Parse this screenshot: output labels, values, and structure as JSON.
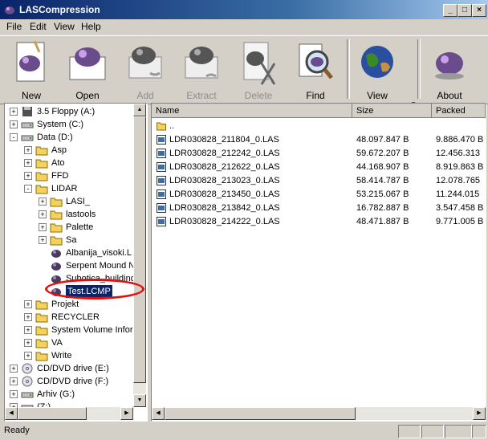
{
  "window": {
    "title": "LASCompression"
  },
  "menu": [
    {
      "label": "File"
    },
    {
      "label": "Edit"
    },
    {
      "label": "View"
    },
    {
      "label": "Help"
    }
  ],
  "toolbar": [
    {
      "label": "New",
      "enabled": true
    },
    {
      "label": "Open",
      "enabled": true
    },
    {
      "label": "Add",
      "enabled": false
    },
    {
      "label": "Extract",
      "enabled": false
    },
    {
      "label": "Delete",
      "enabled": false
    },
    {
      "label": "Find",
      "enabled": true
    },
    {
      "label": "View",
      "enabled": true
    },
    {
      "label": "About",
      "enabled": true
    }
  ],
  "tree": [
    {
      "label": "3.5 Floppy (A:)",
      "icon": "floppy-icon",
      "expander": "+"
    },
    {
      "label": "System (C:)",
      "icon": "drive-icon",
      "expander": "+"
    },
    {
      "label": "Data (D:)",
      "icon": "drive-icon",
      "expander": "-"
    },
    {
      "label": "Asp",
      "icon": "folder-icon",
      "expander": "+"
    },
    {
      "label": "Ato",
      "icon": "folder-icon",
      "expander": "+"
    },
    {
      "label": "FFD",
      "icon": "folder-icon",
      "expander": "+"
    },
    {
      "label": "LIDAR",
      "icon": "folder-icon",
      "expander": "-"
    },
    {
      "label": "LASI_",
      "icon": "folder-icon",
      "expander": "+"
    },
    {
      "label": "lastools",
      "icon": "folder-icon",
      "expander": "+"
    },
    {
      "label": "Palette",
      "icon": "folder-icon",
      "expander": "+"
    },
    {
      "label": "Sa",
      "icon": "folder-icon",
      "expander": "+"
    },
    {
      "label": "Albanija_visoki.L",
      "icon": "archive-icon",
      "expander": ""
    },
    {
      "label": "Serpent Mound N",
      "icon": "archive-icon",
      "expander": ""
    },
    {
      "label": "Subotica_building",
      "icon": "archive-icon",
      "expander": ""
    },
    {
      "label": "Test.LCMP",
      "icon": "archive-icon",
      "expander": "",
      "selected": true
    },
    {
      "label": "Projekt",
      "icon": "folder-icon",
      "expander": "+"
    },
    {
      "label": "RECYCLER",
      "icon": "folder-icon",
      "expander": "+"
    },
    {
      "label": "System Volume Infor",
      "icon": "folder-icon",
      "expander": "+"
    },
    {
      "label": "VA",
      "icon": "folder-icon",
      "expander": "+"
    },
    {
      "label": "Write",
      "icon": "folder-icon",
      "expander": "+"
    },
    {
      "label": "CD/DVD drive (E:)",
      "icon": "cd-drive-icon",
      "expander": "+"
    },
    {
      "label": "CD/DVD drive (F:)",
      "icon": "cd-drive-icon",
      "expander": "+"
    },
    {
      "label": "Arhiv (G:)",
      "icon": "drive-icon",
      "expander": "+"
    },
    {
      "label": "(Z:)",
      "icon": "drive-icon",
      "expander": "+"
    }
  ],
  "list": {
    "columns": [
      "Name",
      "Size",
      "Packed"
    ],
    "rows": [
      {
        "name": "..",
        "size": "",
        "packed": "",
        "icon": "folder-icon"
      },
      {
        "name": "LDR030828_211804_0.LAS",
        "size": "48.097.847 B",
        "packed": "9.886.470 B",
        "icon": "las-file-icon"
      },
      {
        "name": "LDR030828_212242_0.LAS",
        "size": "59.672.207 B",
        "packed": "12.456.313",
        "icon": "las-file-icon"
      },
      {
        "name": "LDR030828_212622_0.LAS",
        "size": "44.168.907 B",
        "packed": "8.919.863 B",
        "icon": "las-file-icon"
      },
      {
        "name": "LDR030828_213023_0.LAS",
        "size": "58.414.787 B",
        "packed": "12.078.765",
        "icon": "las-file-icon"
      },
      {
        "name": "LDR030828_213450_0.LAS",
        "size": "53.215.067 B",
        "packed": "11.244.015",
        "icon": "las-file-icon"
      },
      {
        "name": "LDR030828_213842_0.LAS",
        "size": "16.782.887 B",
        "packed": "3.547.458 B",
        "icon": "las-file-icon"
      },
      {
        "name": "LDR030828_214222_0.LAS",
        "size": "48.471.887 B",
        "packed": "9.771.005 B",
        "icon": "las-file-icon"
      }
    ]
  },
  "status": {
    "text": "Ready"
  },
  "colors": {
    "selection": "#0a246a",
    "highlight_ring": "#e01010",
    "folder": "#f5d35b"
  }
}
